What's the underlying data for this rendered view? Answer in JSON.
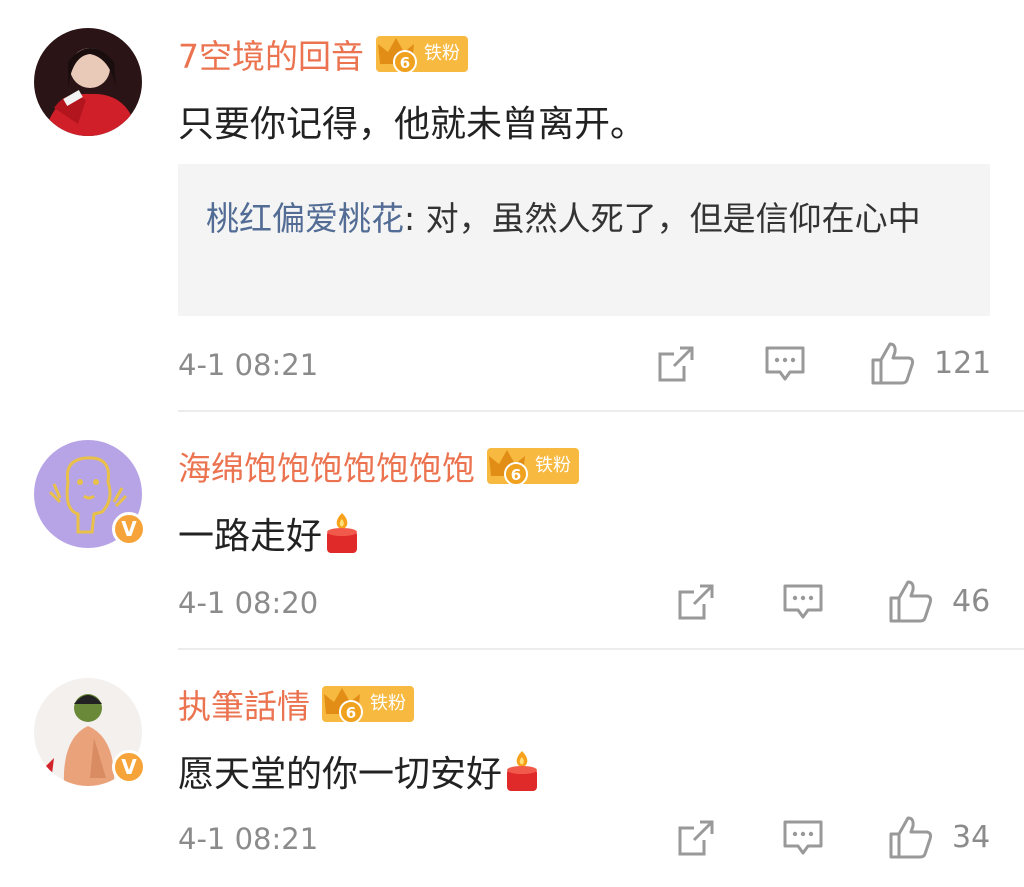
{
  "comments": [
    {
      "username": "7空境的回音",
      "fan_badge": "铁粉",
      "fan_level": "6",
      "text": "只要你记得，他就未曾离开。",
      "reply": {
        "username": "桃红偏爱桃花",
        "text": ": 对，虽然人死了，但是信仰在心中"
      },
      "time": "4-1 08:21",
      "likes": "121",
      "verified": false
    },
    {
      "username": "海绵饱饱饱饱饱饱饱",
      "fan_badge": "铁粉",
      "fan_level": "6",
      "text": "一路走好",
      "time": "4-1 08:20",
      "likes": "46",
      "verified": true
    },
    {
      "username": "执筆話情",
      "fan_badge": "铁粉",
      "fan_level": "6",
      "text": "愿天堂的你一切安好",
      "time": "4-1 08:21",
      "likes": "34",
      "verified": true
    }
  ],
  "icons": {
    "share": "share-icon",
    "comment": "comment-icon",
    "like": "thumbs-up-icon",
    "verified": "verified-v-icon",
    "emoji": "candle-emoji-icon"
  },
  "colors": {
    "username": "#eb7350",
    "reply_name": "#526c95",
    "badge": "#f7b940",
    "meta": "#8b8b8b"
  },
  "verified_mark": "V"
}
